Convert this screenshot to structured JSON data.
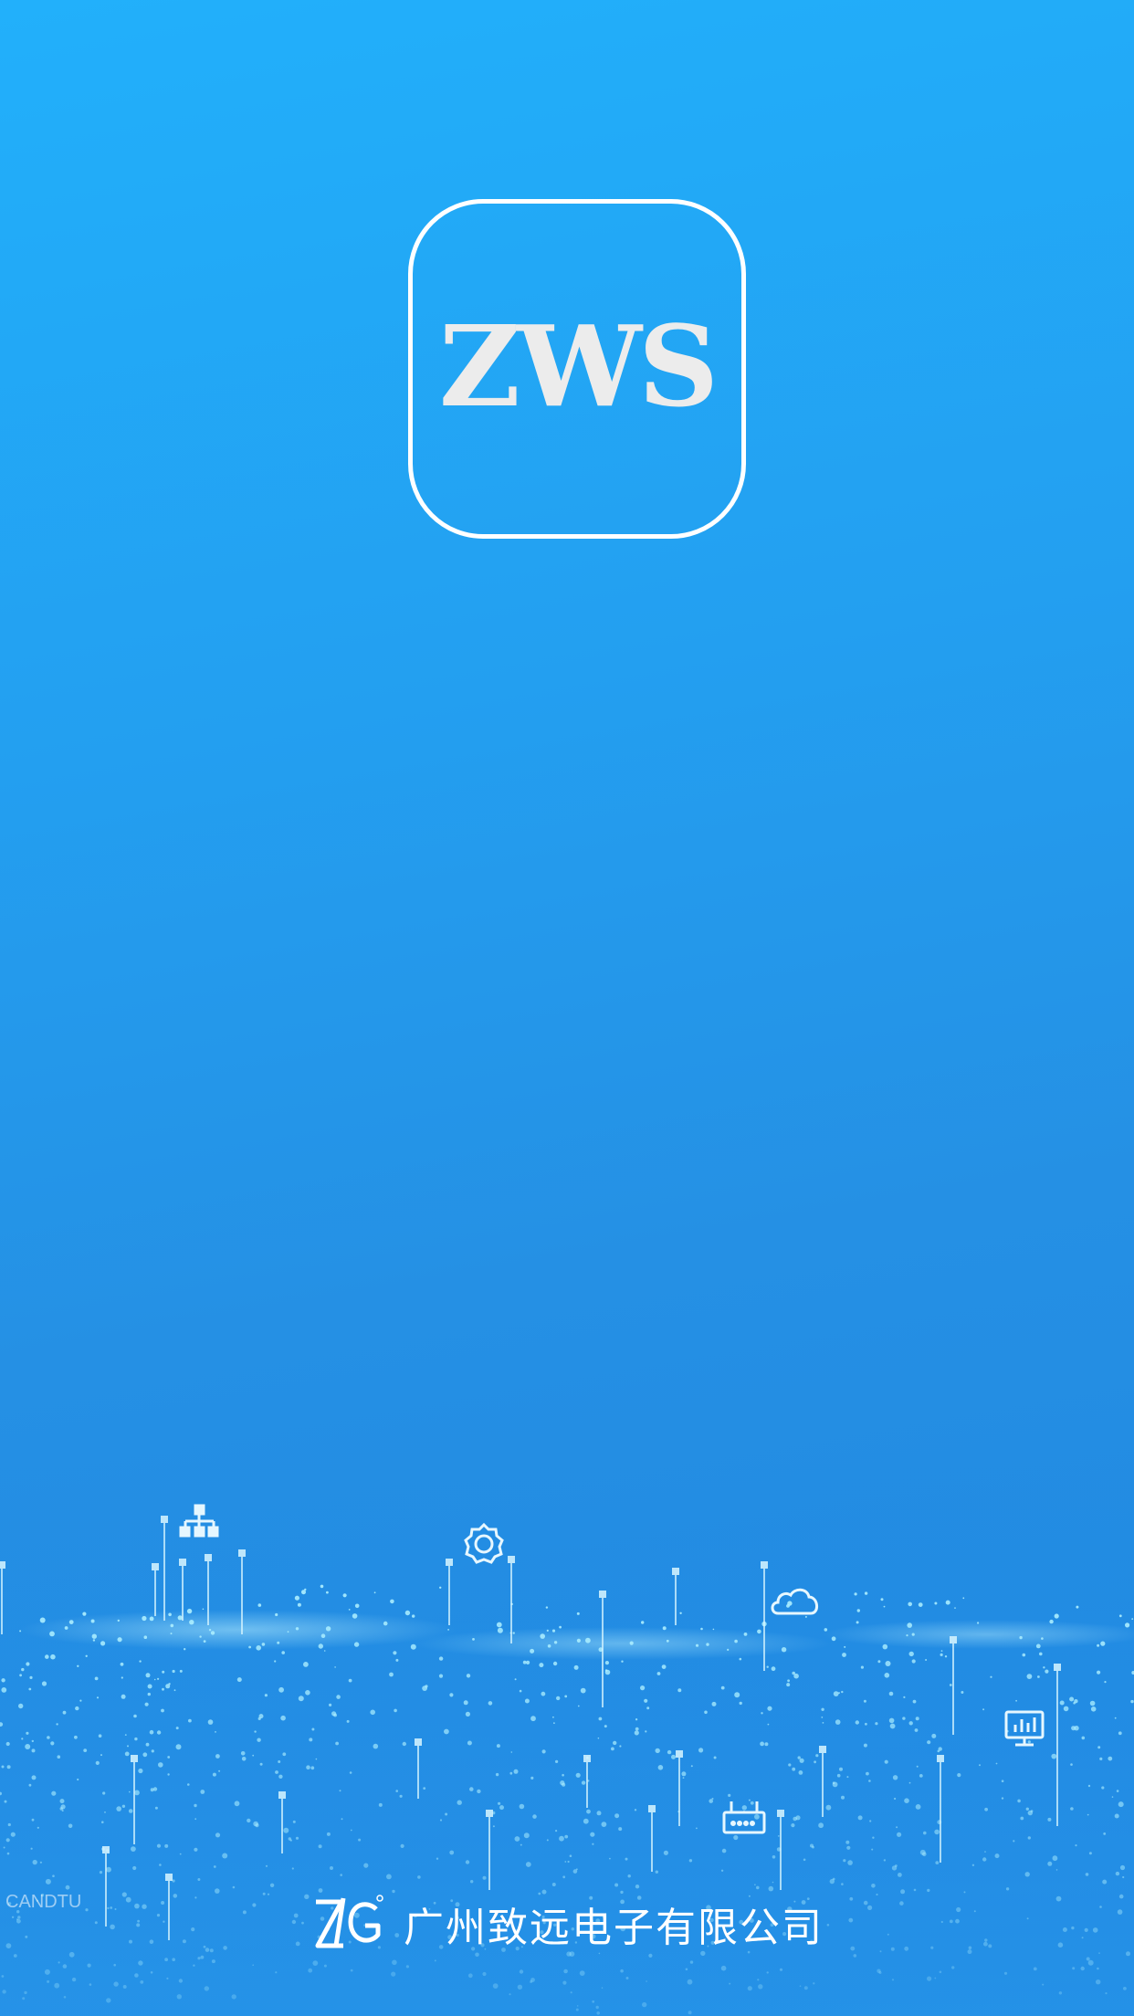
{
  "splash": {
    "app_logo_text": "ZWS",
    "company_name": "广州致远电子有限公司",
    "company_logo_text": "ZLG",
    "watermark_text": "CANDTU"
  },
  "colors": {
    "background_top": "#22b0fb",
    "background_bottom": "#1f86e0",
    "logo_border": "#ffffff",
    "logo_text": "#ececec"
  },
  "icons": [
    "hierarchy-icon",
    "gear-icon",
    "cloud-icon",
    "router-icon",
    "monitor-chart-icon",
    "zlg-logo-icon"
  ]
}
